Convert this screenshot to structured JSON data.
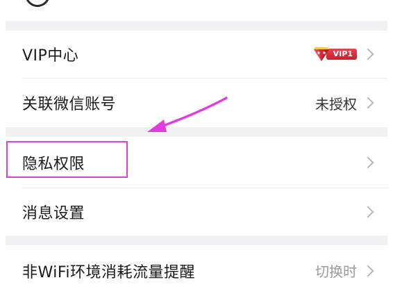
{
  "settings": {
    "vip": {
      "label": "VIP中心",
      "badge_text": "VIP1"
    },
    "wechat": {
      "label": "关联微信账号",
      "value": "未授权"
    },
    "privacy": {
      "label": "隐私权限"
    },
    "notifications": {
      "label": "消息设置"
    },
    "data_saver": {
      "label": "非WiFi环境消耗流量提醒",
      "value": "切换时"
    }
  },
  "colors": {
    "highlight": "#e23bdf",
    "arrow": "#e23bdf",
    "section_gap": "#f1f1f3",
    "vip_red": "#d4283a"
  },
  "icons": {
    "chevron": "chevron-right-icon",
    "vip_gem": "vip-gem-icon"
  }
}
